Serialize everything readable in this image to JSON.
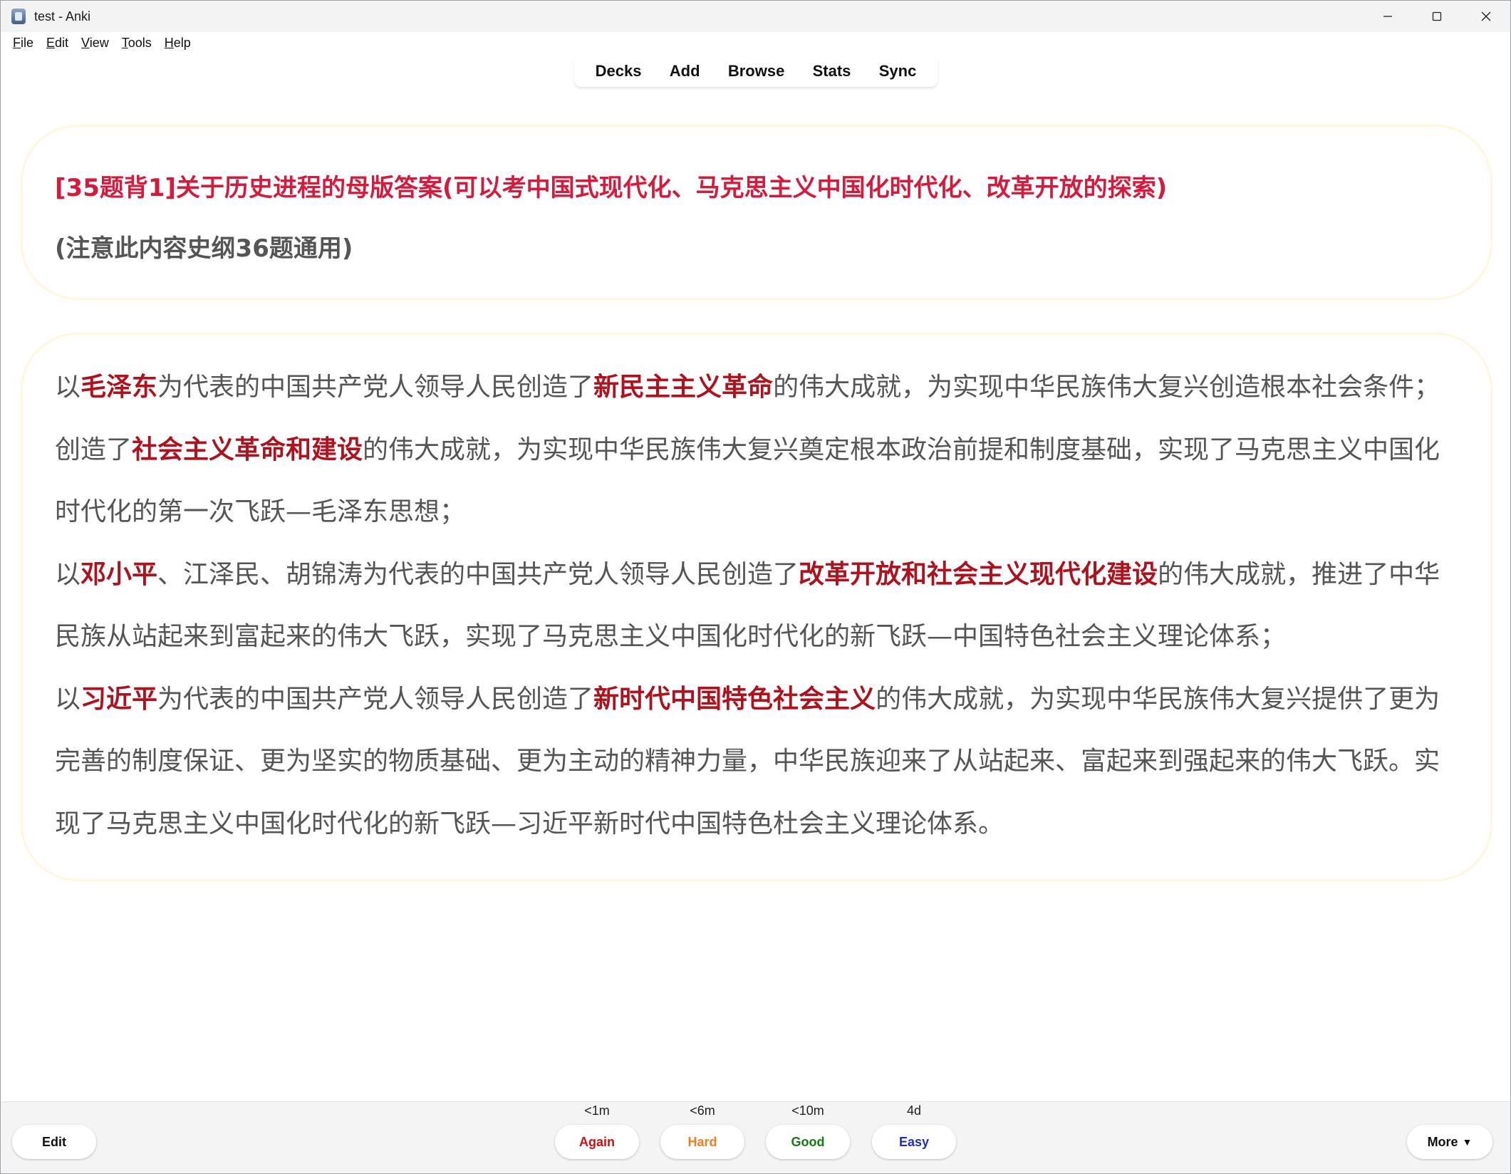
{
  "window": {
    "title": "test - Anki",
    "controls": {
      "minimize": "minimize-icon",
      "maximize": "maximize-icon",
      "close": "close-icon"
    }
  },
  "menu": {
    "items": [
      {
        "label": "File",
        "mnemonic": "F",
        "rest": "ile"
      },
      {
        "label": "Edit",
        "mnemonic": "E",
        "rest": "dit"
      },
      {
        "label": "View",
        "mnemonic": "V",
        "rest": "iew"
      },
      {
        "label": "Tools",
        "mnemonic": "T",
        "rest": "ools"
      },
      {
        "label": "Help",
        "mnemonic": "H",
        "rest": "elp"
      }
    ]
  },
  "toolbar": {
    "items": [
      "Decks",
      "Add",
      "Browse",
      "Stats",
      "Sync"
    ]
  },
  "card": {
    "question_title": "[35题背1]关于历史进程的母版答案(可以考中国式现代化、马克思主义中国化时代化、改革开放的探索)",
    "question_note": "(注意此内容史纲36题通用)",
    "answer": [
      [
        {
          "t": "以"
        },
        {
          "t": "毛泽东",
          "hl": true
        },
        {
          "t": "为代表的中国共产党人领导人民创造了"
        },
        {
          "t": "新民主主义革命",
          "hl": true
        },
        {
          "t": "的伟大成就，为实现中华民族伟大复兴创造根本社会条件；"
        }
      ],
      [
        {
          "t": "创造了"
        },
        {
          "t": "社会主义革命和建设",
          "hl": true
        },
        {
          "t": "的伟大成就，为实现中华民族伟大复兴奠定根本政治前提和制度基础，实现了马克思主义中国化"
        }
      ],
      [
        {
          "t": "时代化的第一次飞跃—毛泽东思想；"
        }
      ],
      [
        {
          "t": "以"
        },
        {
          "t": "邓小平",
          "hl": true
        },
        {
          "t": "、江泽民、胡锦涛为代表的中国共产党人领导人民创造了"
        },
        {
          "t": "改革开放和社会主义现代化建设",
          "hl": true
        },
        {
          "t": "的伟大成就，推进了中华"
        }
      ],
      [
        {
          "t": "民族从站起来到富起来的伟大飞跃，实现了马克思主义中国化时代化的新飞跃—中国特色社会主义理论体系；"
        }
      ],
      [
        {
          "t": "以"
        },
        {
          "t": "习近平",
          "hl": true
        },
        {
          "t": "为代表的中国共产党人领导人民创造了"
        },
        {
          "t": "新时代中国特色社会主义",
          "hl": true
        },
        {
          "t": "的伟大成就，为实现中华民族伟大复兴提供了更为"
        }
      ],
      [
        {
          "t": "完善的制度保证、更为坚实的物质基础、更为主动的精神力量，中华民族迎来了从站起来、富起来到强起来的伟大飞跃。实"
        }
      ],
      [
        {
          "t": "现了马克思主义中国化时代化的新飞跃—习近平新时代中国特色杜会主义理论体系。"
        }
      ]
    ],
    "colors": {
      "title": "#d61a3c",
      "highlight": "#b0121d",
      "body": "#555555",
      "border": "#fff6dc"
    }
  },
  "bottombar": {
    "edit_label": "Edit",
    "more_label": "More",
    "more_icon": "triangle-down-icon",
    "answers": [
      {
        "label": "Again",
        "interval": "<1m",
        "color": "#d10f0f"
      },
      {
        "label": "Hard",
        "interval": "<6m",
        "color": "#f07d1f"
      },
      {
        "label": "Good",
        "interval": "<10m",
        "color": "#127c12"
      },
      {
        "label": "Easy",
        "interval": "4d",
        "color": "#1d2fc2"
      }
    ]
  }
}
